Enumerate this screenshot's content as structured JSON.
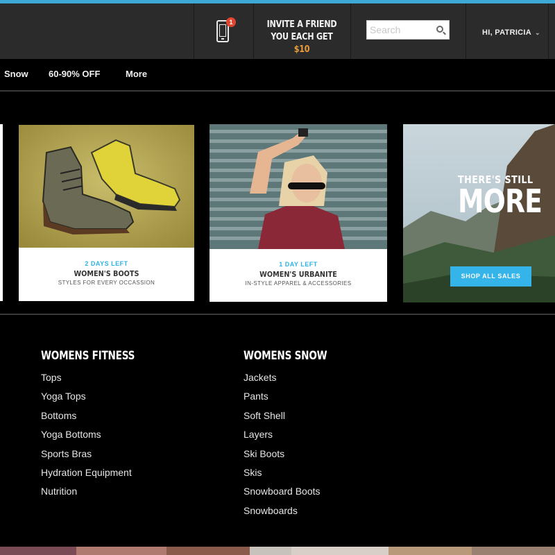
{
  "header": {
    "notification_count": "1",
    "invite_line1": "INVITE A FRIEND",
    "invite_line2": "YOU EACH GET ",
    "invite_amount": "$10",
    "search_placeholder": "Search",
    "user_greeting": "HI, PATRICIA",
    "accent_color": "#3ea9d6"
  },
  "nav": {
    "items": [
      "Snow",
      "60-90% OFF",
      "More"
    ]
  },
  "sales": [
    {
      "days_left": "2 DAYS LEFT",
      "title": "WOMEN'S BOOTS",
      "subtitle": "STYLES FOR EVERY OCCASSION"
    },
    {
      "days_left": "1 DAY LEFT",
      "title": "WOMEN'S URBANITE",
      "subtitle": "IN-STYLE APPAREL & ACCESSORIES"
    }
  ],
  "more_card": {
    "line1": "THERE'S STILL",
    "line2": "MORE",
    "button": "SHOP ALL SALES"
  },
  "menu": {
    "fitness": {
      "heading": "WOMENS FITNESS",
      "items": [
        "Tops",
        "Yoga Tops",
        "Bottoms",
        "Yoga Bottoms",
        "Sports Bras",
        "Hydration Equipment",
        "Nutrition"
      ]
    },
    "snow": {
      "heading": "WOMENS SNOW",
      "items": [
        "Jackets",
        "Pants",
        "Soft Shell",
        "Layers",
        "Ski Boots",
        "Skis",
        "Snowboard Boots",
        "Snowboards"
      ]
    }
  }
}
